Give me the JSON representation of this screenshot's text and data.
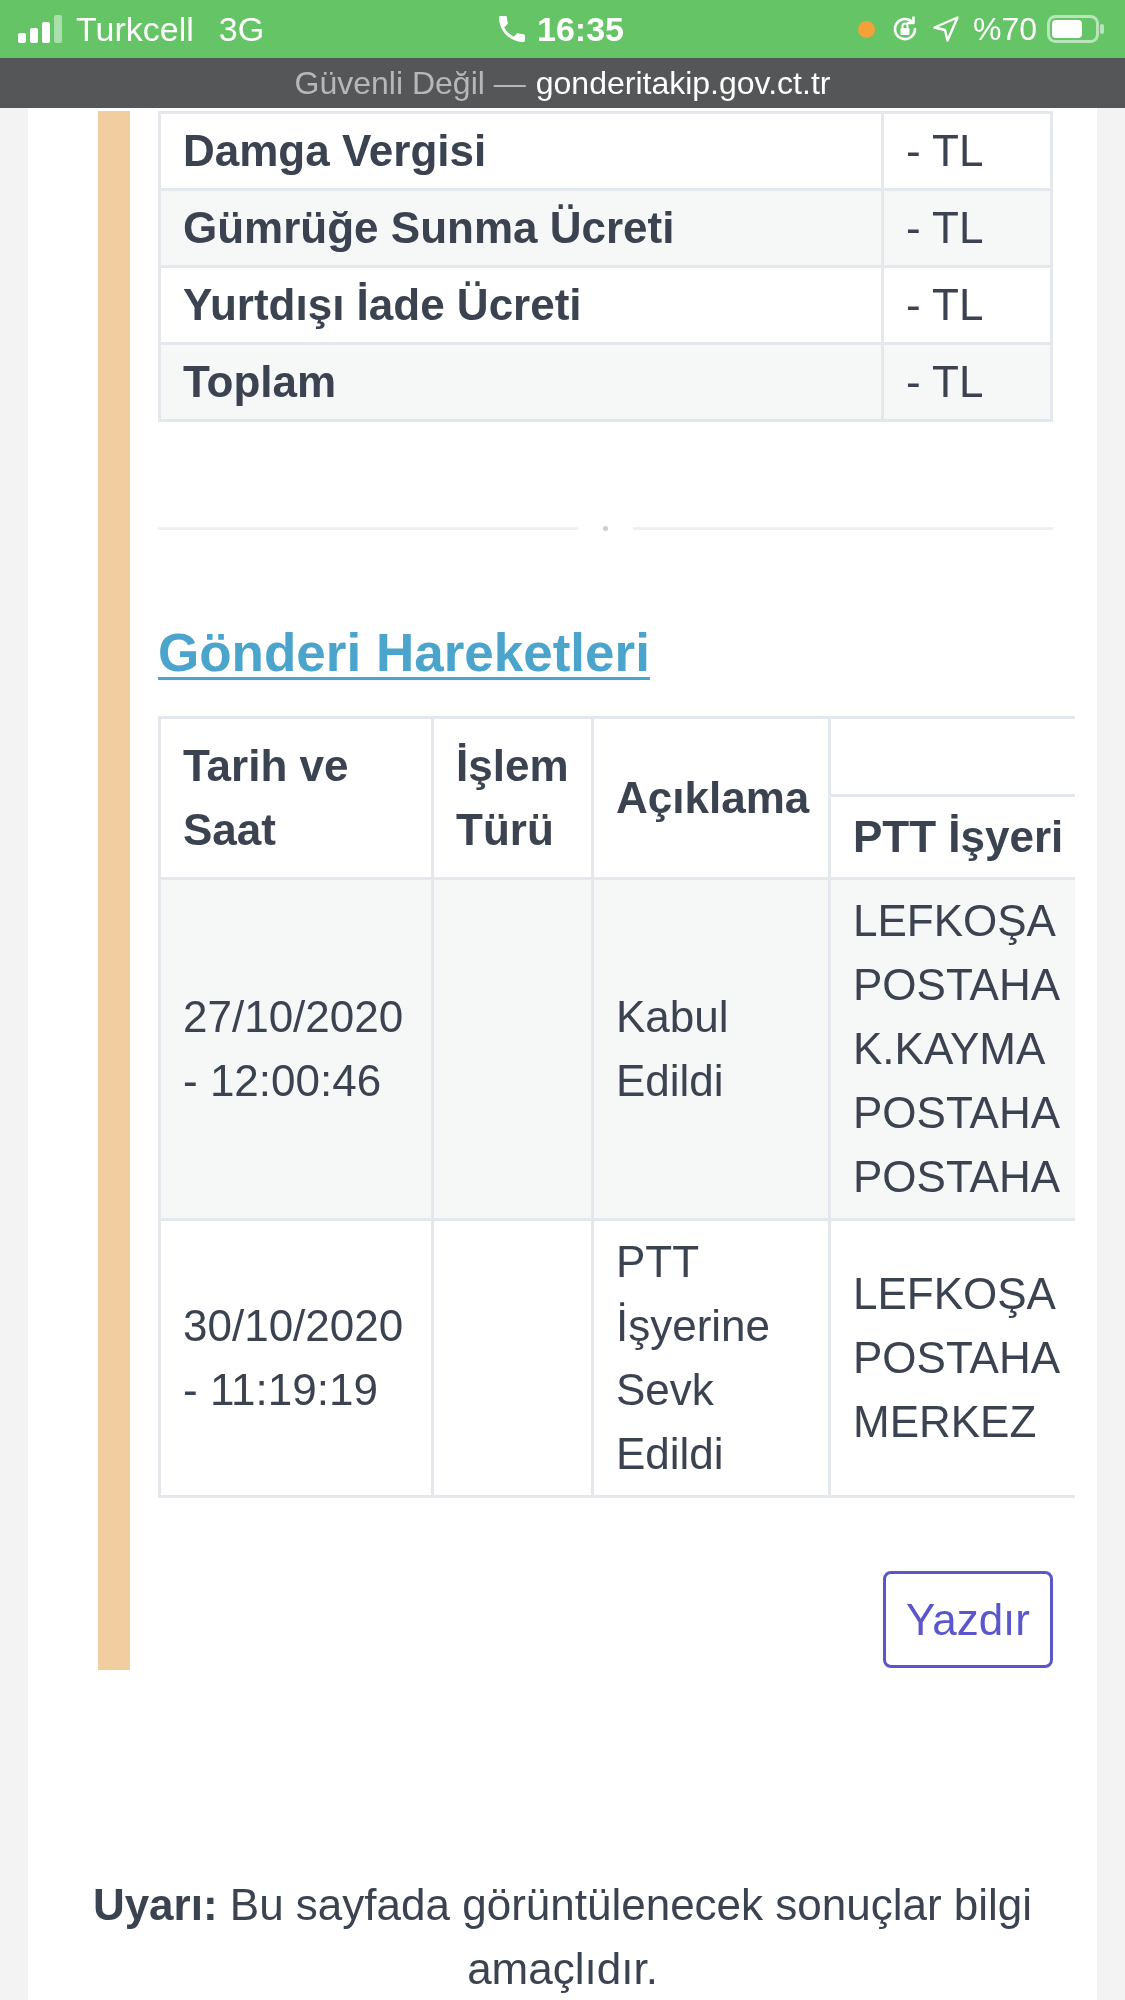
{
  "status_bar": {
    "carrier": "Turkcell",
    "network": "3G",
    "time": "16:35",
    "battery": "%70"
  },
  "address_bar": {
    "security": "Güvenli Değil —",
    "url": "gonderitakip.gov.ct.tr"
  },
  "charges_table": {
    "rows": [
      {
        "label": "Damga Vergisi",
        "amount": "- TL"
      },
      {
        "label": "Gümrüğe Sunma Ücreti",
        "amount": "- TL"
      },
      {
        "label": "Yurtdışı İade Ücreti",
        "amount": "- TL"
      },
      {
        "label": "Toplam",
        "amount": "- TL"
      }
    ]
  },
  "movements": {
    "title": "Gönderi Hareketleri",
    "columns": [
      {
        "label": "Tarih ve Saat",
        "kind": "single"
      },
      {
        "label": "İşlem Türü",
        "kind": "single"
      },
      {
        "label": "Açıklama",
        "kind": "single"
      },
      {
        "label": "PTT İşyeri",
        "kind": "grouped"
      }
    ],
    "rows": [
      {
        "date_time": "27/10/2020 - 12:00:46",
        "description": "Kabul Edildi",
        "ptt_office": [
          "LEFKOŞA",
          "POSTAHA",
          "K.KAYMA",
          "POSTAHA",
          "POSTAHA"
        ]
      },
      {
        "date_time": "30/10/2020 - 11:19:19",
        "description": "PTT İşyerine Sevk Edildi",
        "ptt_office": [
          "LEFKOŞA",
          "POSTAHA",
          "MERKEZ"
        ]
      }
    ]
  },
  "print_button": {
    "label": "Yazdır"
  },
  "notice": "**Uyarı:** Bu sayfada görüntülenecek sonuçlar bilgi amaçlıdır."
}
